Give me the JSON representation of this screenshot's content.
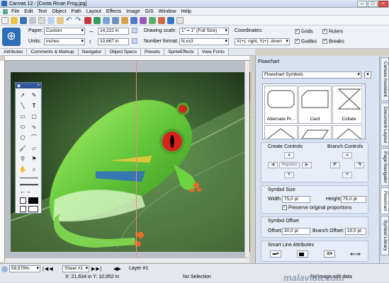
{
  "window": {
    "title": "Canvas 12 - [Costa Rican Frog.jpg]"
  },
  "menu": [
    "File",
    "Edit",
    "Text",
    "Object",
    "Path",
    "Layout",
    "Effects",
    "Image",
    "GIS",
    "Window",
    "Help"
  ],
  "props": {
    "paper_label": "Paper:",
    "paper_value": "Custom",
    "units_label": "Units:",
    "units_value": "inches",
    "width_value": "14,222 in",
    "height_value": "10,667 in",
    "scale_label": "Drawing scale:",
    "scale_value": "1\" = 1\" (Full Size)",
    "numfmt_label": "Number format:",
    "numfmt_value": "N.xx3",
    "coord_label": "Coordinates:",
    "coord_value": "X(+): right, Y(+): down",
    "grids": "Grids",
    "rulers": "Rulers",
    "guides": "Guides",
    "breaks": "Breaks"
  },
  "tabs": [
    "Attributes",
    "Comments & Markup",
    "Navigator",
    "Object Specs",
    "Presets",
    "SpriteEffects",
    "View Fonts"
  ],
  "panel": {
    "title": "Flowchart",
    "category": "Flowchart Symbols",
    "shapes": [
      "Alternate Pr...",
      "Card",
      "Collate"
    ],
    "create_controls": "Create Controls",
    "branch_controls": "Branch Controls",
    "replace": "Replace",
    "symbol_size": "Symbol Size",
    "width_label": "Width:",
    "width_value": "75,0 pt",
    "height_label": "Height:",
    "height_value": "75,0 pt",
    "preserve": "Preserve original proportions",
    "symbol_offset": "Symbol Offset",
    "offset_label": "Offset:",
    "offset_value": "30,0 pt",
    "branch_offset_label": "Branch Offset:",
    "branch_offset_value": "10,0 pt",
    "smart_line": "Smart Line Attributes"
  },
  "side_tabs": [
    "Canvas Assistant",
    "Document Layout",
    "Page Navigator",
    "Flowchart",
    "Symbol Library"
  ],
  "status": {
    "zoom": "59,579%",
    "sheet": "Sheet #1",
    "layer": "Layer #1",
    "coords": "X: 21,634 in Y: 10,952 in",
    "selection": "No Selection",
    "image_edit": "No image edit data"
  },
  "watermark": "malavida.com"
}
